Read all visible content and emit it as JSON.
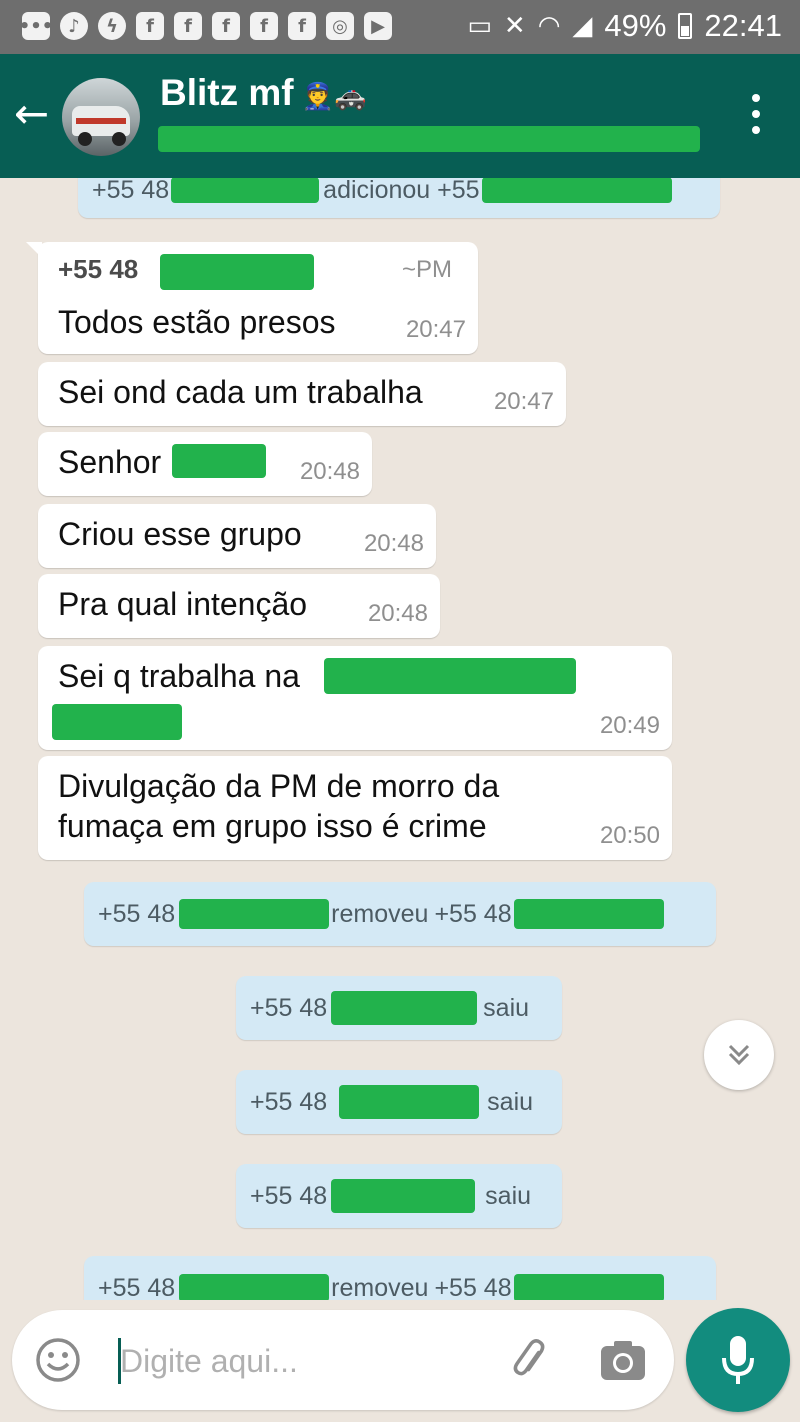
{
  "status_bar": {
    "battery": "49%",
    "time": "22:41",
    "notification_icons": [
      "chat-icon",
      "music-icon",
      "messenger-icon",
      "facebook-icon",
      "facebook-icon",
      "facebook-icon",
      "facebook-icon",
      "facebook-icon",
      "instagram-icon",
      "youtube-icon"
    ],
    "system_icons": [
      "cast-icon",
      "mute-icon",
      "wifi-icon",
      "signal-icon",
      "battery-icon"
    ]
  },
  "header": {
    "group_name": "Blitz mf",
    "emoji": "👮🚓",
    "back_icon": "arrow-left-icon",
    "menu_icon": "more-vert-icon"
  },
  "chat": {
    "top_event": {
      "prefix": "+55 48",
      "action": "adicionou +55"
    },
    "messages": [
      {
        "sender": "+55 48",
        "push_name": "~PM",
        "text": "Todos estão presos",
        "time": "20:47"
      },
      {
        "text": "Sei ond cada um trabalha",
        "time": "20:47"
      },
      {
        "text": "Senhor",
        "time": "20:48"
      },
      {
        "text": "Criou esse grupo",
        "time": "20:48"
      },
      {
        "text": "Pra qual intenção",
        "time": "20:48"
      },
      {
        "text": "Sei q trabalha na",
        "time": "20:49"
      },
      {
        "line1": "Divulgação da PM de morro da",
        "line2": "fumaça em grupo isso é crime",
        "time": "20:50"
      }
    ],
    "events": [
      {
        "prefix": "+55 48",
        "action": "removeu",
        "target": "+55 48"
      },
      {
        "prefix": "+55 48",
        "action": "saiu"
      },
      {
        "prefix": "+55 48",
        "action": "saiu"
      },
      {
        "prefix": "+55 48",
        "action": "saiu"
      },
      {
        "prefix": "+55 48",
        "action": "removeu",
        "target": "+55 48"
      }
    ]
  },
  "composer": {
    "placeholder": "Digite aqui...",
    "emoji_icon": "smiley-icon",
    "attach_icon": "paperclip-icon",
    "camera_icon": "camera-icon",
    "mic_icon": "microphone-icon",
    "scroll_icon": "double-chevron-down-icon"
  },
  "colors": {
    "header": "#075e54",
    "status_bar": "#6e6e6e",
    "chat_background": "#ece5dd",
    "system_bubble": "#d4e9f5",
    "redaction": "#22b24c",
    "mic_button": "#128c7e"
  }
}
